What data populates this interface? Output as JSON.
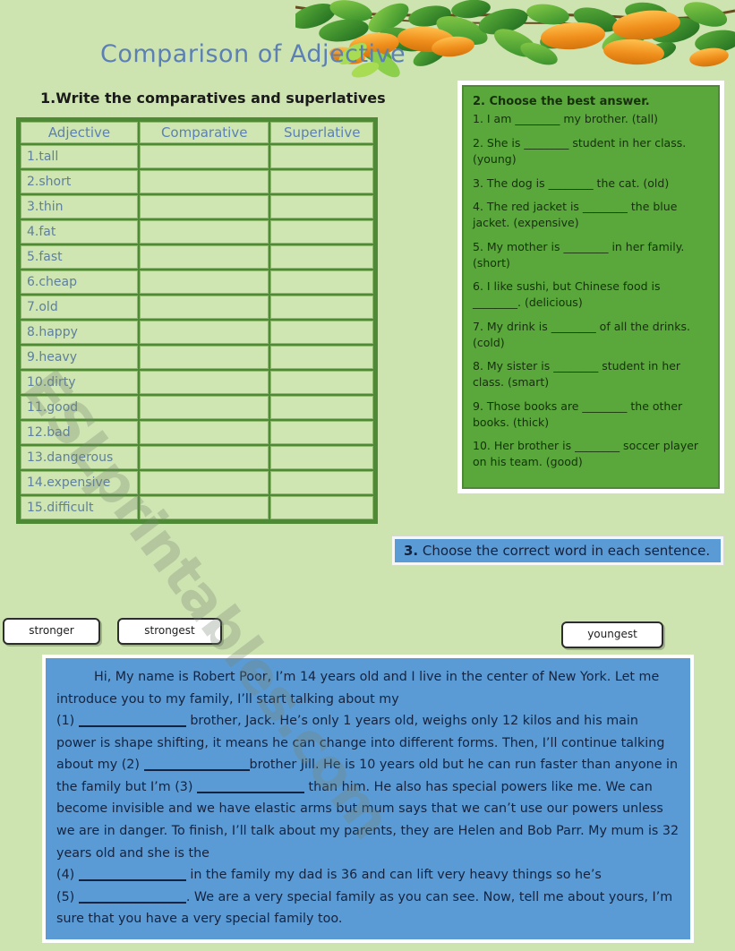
{
  "page": {
    "title": "Comparison of Adjective",
    "background_color": "#cde3b0",
    "watermark": "ESLprintables.com"
  },
  "exercise1": {
    "instruction": "1.Write the comparatives and superlatives",
    "columns": [
      "Adjective",
      "Comparative",
      "Superlative"
    ],
    "rows": [
      "1.tall",
      "2.short",
      "3.thin",
      "4.fat",
      "5.fast",
      "6.cheap",
      "7.old",
      "8.happy",
      "9.heavy",
      "10.dirty",
      "11.good",
      "12.bad",
      "13.dangerous",
      "14.expensive",
      "15.difficult"
    ]
  },
  "exercise2": {
    "heading": "2. Choose the best answer.",
    "panel_color": "#5aa83c",
    "questions": [
      "1. I am ________ my brother. (tall)",
      "2. She is ________ student in her class. (young)",
      "3. The dog is ________ the cat. (old)",
      "4. The red jacket is ________ the blue jacket. (expensive)",
      "5. My mother is ________ in her family. (short)",
      "6. I like sushi, but Chinese food is ________. (delicious)",
      "7. My drink is ________ of all the drinks. (cold)",
      "8. My sister is ________ student in her class. (smart)",
      "9. Those books are ________ the other books. (thick)",
      "10. Her brother is ________ soccer player on his team. (good)"
    ]
  },
  "exercise3": {
    "heading_number": "3.",
    "heading_text": " Choose the correct word in each sentence.",
    "bar_color": "#5b9bd5",
    "word_boxes": [
      "stronger",
      "strongest",
      "youngest"
    ],
    "passage": {
      "p1": "Hi, My name is Robert Poor, I’m 14 years old and I live in the center of New York. Let me introduce you to my family, I’ll start talking about my",
      "n1": "(1)",
      "p2": " brother, Jack. He’s only 1 years old, weighs only 12 kilos and his main power is shape shifting, it means he can change into different forms. Then, I’ll continue talking about my ",
      "n2": "(2)",
      "p3": "brother Jill. He is 10 years old but he can run faster than anyone in the family but I’m ",
      "n3": "(3)",
      "p4": " than him. He also has special powers like me. We can become invisible and we have elastic arms but mum says that we can’t use our powers unless we are in danger. To finish, I’ll talk about my parents, they are Helen and Bob Parr. My mum is 32 years old and she is the ",
      "n4": "(4)",
      "p5": " in the family my dad is 36 and can lift very heavy things so he’s ",
      "n5": "(5)",
      "p6": ". We are a very special family as you can see. Now, tell me about yours, I’m sure that you have a very special family too."
    }
  }
}
